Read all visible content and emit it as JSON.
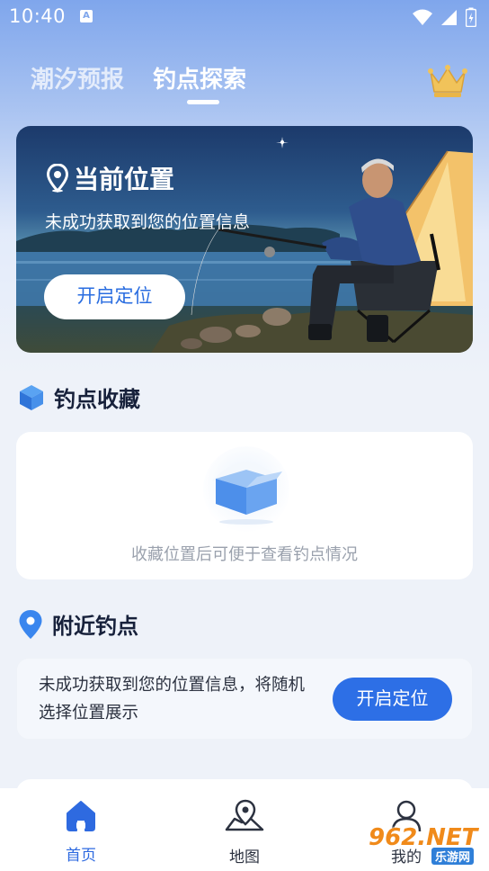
{
  "status_bar": {
    "time": "10:40",
    "a_icon": "A"
  },
  "header": {
    "tabs": [
      {
        "label": "潮汐预报",
        "active": false
      },
      {
        "label": "钓点探索",
        "active": true
      }
    ],
    "crown_icon": "crown-icon"
  },
  "banner": {
    "title": "当前位置",
    "subtitle": "未成功获取到您的位置信息",
    "button_label": "开启定位"
  },
  "favorites": {
    "title": "钓点收藏",
    "empty_hint": "收藏位置后可便于查看钓点情况"
  },
  "nearby": {
    "title": "附近钓点",
    "message": "未成功获取到您的位置信息，将随机选择位置展示",
    "button_label": "开启定位"
  },
  "bottom_nav": {
    "items": [
      {
        "label": "首页",
        "icon": "home-icon",
        "active": true
      },
      {
        "label": "地图",
        "icon": "map-icon",
        "active": false
      },
      {
        "label": "我的",
        "icon": "user-icon",
        "active": false
      }
    ]
  },
  "watermark": {
    "text": "962.NET",
    "sub": "乐游网"
  },
  "colors": {
    "accent": "#2d6fe6",
    "background": "#eef2f9",
    "gradient_top": "#7fa6ec"
  }
}
